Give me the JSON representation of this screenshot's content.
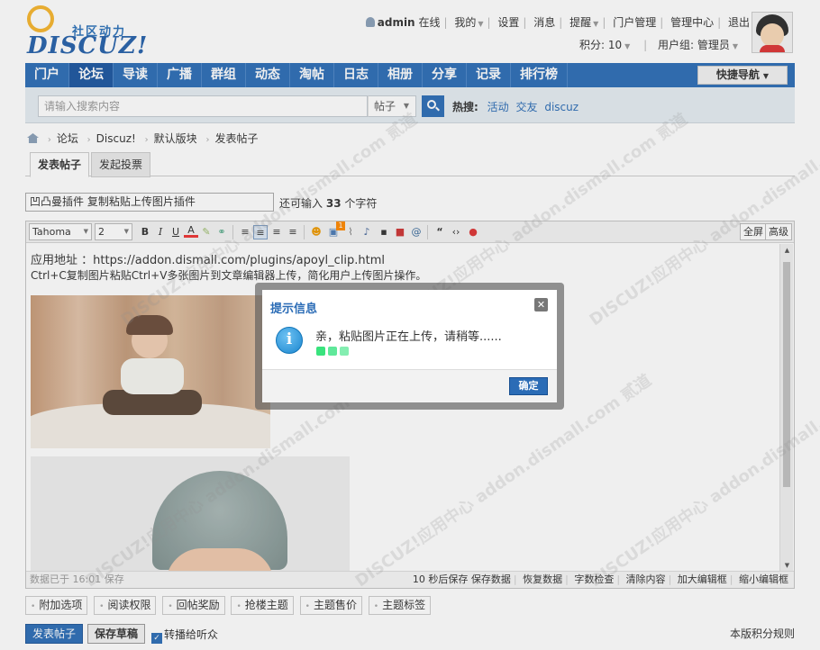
{
  "logo": {
    "slogan": "社区动力",
    "brand": "DISCUZ!"
  },
  "topbar": {
    "username": "admin",
    "online": "在线",
    "links": [
      "我的",
      "设置",
      "消息",
      "提醒",
      "门户管理",
      "管理中心",
      "退出"
    ],
    "points_label": "积分: 10",
    "group_label": "用户组: 管理员"
  },
  "nav": {
    "items": [
      "门户",
      "论坛",
      "导读",
      "广播",
      "群组",
      "动态",
      "淘帖",
      "日志",
      "相册",
      "分享",
      "记录",
      "排行榜"
    ],
    "active": "论坛",
    "quick": "快捷导航"
  },
  "search": {
    "placeholder": "请输入搜索内容",
    "type": "帖子",
    "hot_label": "热搜:",
    "hot": [
      "活动",
      "交友",
      "discuz"
    ]
  },
  "breadcrumb": [
    "论坛",
    "Discuz!",
    "默认版块",
    "发表帖子"
  ],
  "tabs": [
    "发表帖子",
    "发起投票"
  ],
  "subject": {
    "value": "凹凸曼插件 复制粘贴上传图片插件",
    "remain_prefix": "还可输入",
    "remain_count": "33",
    "remain_suffix": "个字符"
  },
  "toolbar": {
    "font": "Tahoma",
    "size": "2",
    "fullscreen": "全屏",
    "advanced": "高级",
    "badge": "1"
  },
  "editor": {
    "line1": "应用地址 ：https://addon.dismall.com/plugins/apoyl_clip.html",
    "line2": "Ctrl+C复制图片粘贴Ctrl+V多张图片到文章编辑器上传，简化用户上传图片操作。"
  },
  "statusbar": {
    "saved": "数据已于 16:01 保存",
    "right": [
      "10 秒后保存 保存数据",
      "恢复数据",
      "字数检查",
      "清除内容",
      "加大编辑框",
      "缩小编辑框"
    ]
  },
  "options": [
    "附加选项",
    "阅读权限",
    "回帖奖励",
    "抢楼主题",
    "主题售价",
    "主题标签"
  ],
  "post_label": "发表帖子",
  "draft_label": "保存草稿",
  "share_label": "转播给听众",
  "rules_label": "本版积分规则",
  "modal": {
    "title": "提示信息",
    "message": "亲，粘贴图片正在上传，请稍等......",
    "ok": "确定"
  },
  "watermark": "DISCUZ!应用中心 addon.dismall.com 贰道"
}
